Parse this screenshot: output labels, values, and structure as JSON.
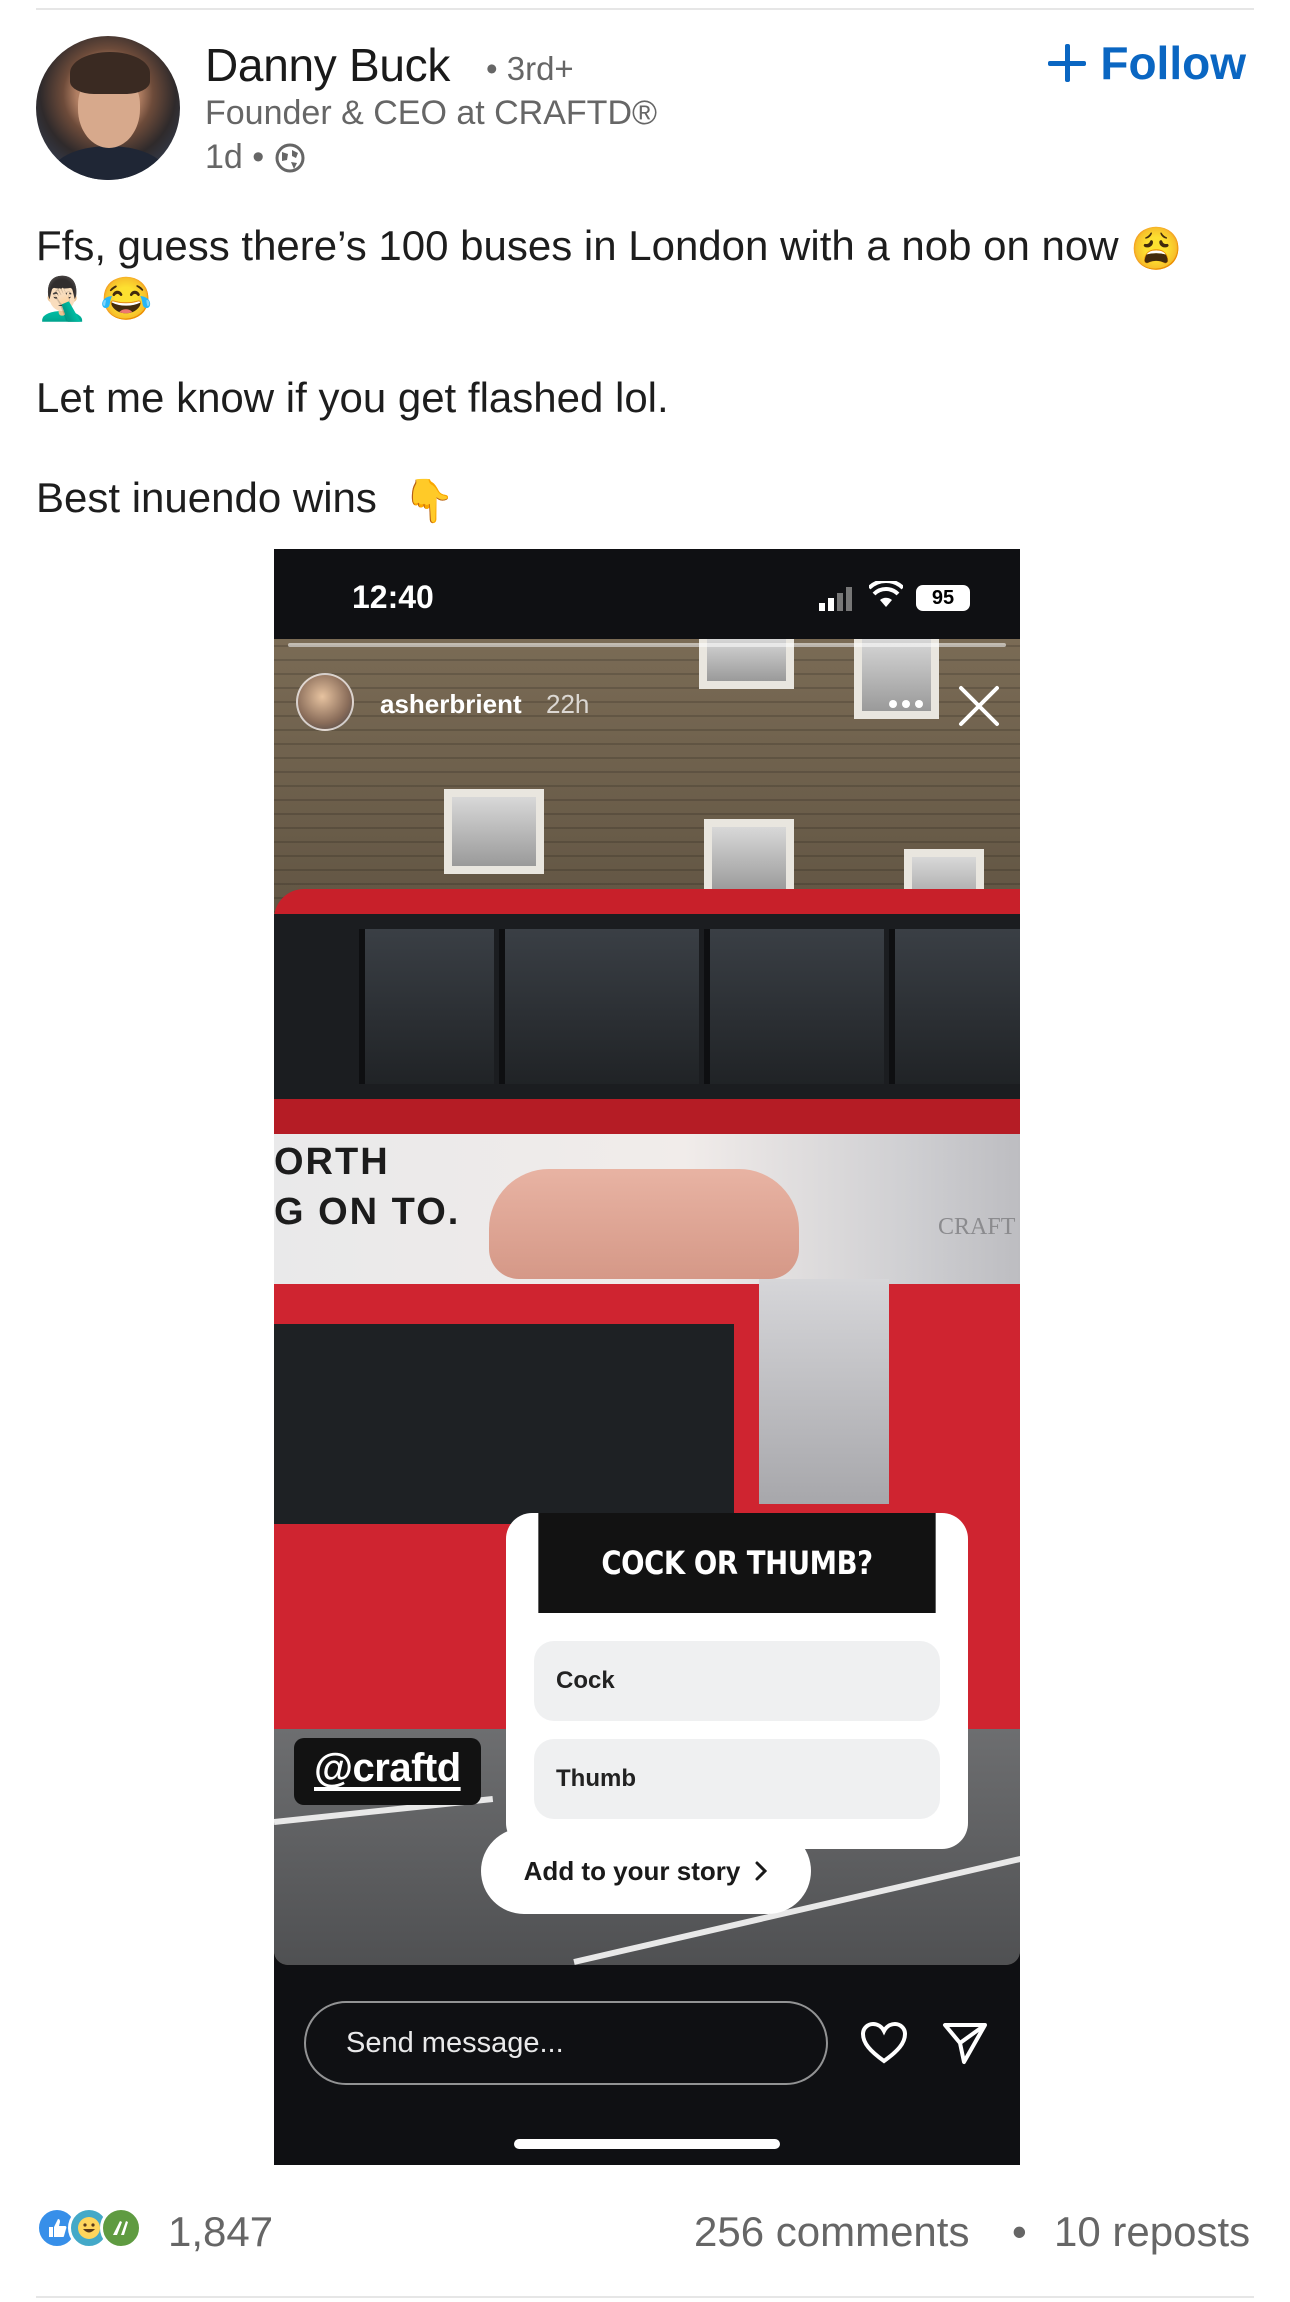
{
  "author": {
    "name": "Danny Buck",
    "degree": "• 3rd+",
    "headline": "Founder & CEO at CRAFTD®",
    "age": "1d •",
    "follow_label": "Follow"
  },
  "post": {
    "line1": "Ffs, guess there’s 100 buses in London with a nob on now",
    "line1_emoji": "😩",
    "line2_emojis": "🤦🏻‍♂️ 😂",
    "line3": "Let me know if you get flashed lol.",
    "line4": "Best inuendo wins",
    "line4_emoji": "👇"
  },
  "story": {
    "status_time": "12:40",
    "battery": "95",
    "username": "asherbrient",
    "posted_ago": "22h",
    "ad_line1": "ORTH",
    "ad_line2": "G ON TO.",
    "ad_logo": "CRAFT",
    "poll_question": "COCK OR THUMB?",
    "poll_options": [
      "Cock",
      "Thumb"
    ],
    "mention_tag": "@craftd",
    "add_to_story": "Add to your story",
    "message_placeholder": "Send message..."
  },
  "stats": {
    "reactions_count": "1,847",
    "comments": "256 comments",
    "separator": "•",
    "reposts": "10 reposts"
  },
  "colors": {
    "accent": "#0a66c2",
    "secondary_text": "#666666",
    "bus_red": "#cf2430"
  }
}
